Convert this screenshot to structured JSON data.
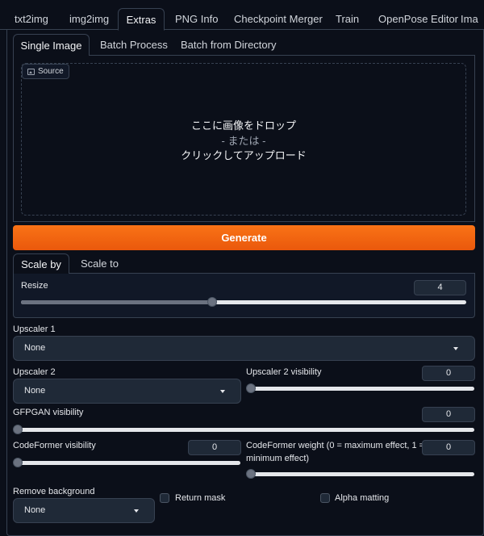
{
  "top_tabs": [
    "txt2img",
    "img2img",
    "Extras",
    "PNG Info",
    "Checkpoint Merger",
    "Train",
    "OpenPose Editor",
    "Ima"
  ],
  "sub_tabs": [
    "Single Image",
    "Batch Process",
    "Batch from Directory"
  ],
  "source": {
    "badge_label": "Source",
    "drop_line1": "ここに画像をドロップ",
    "drop_line2": "- または -",
    "drop_line3": "クリックしてアップロード"
  },
  "generate_label": "Generate",
  "scale_tabs": [
    "Scale by",
    "Scale to"
  ],
  "resize": {
    "label": "Resize",
    "value": "4",
    "fraction": 0.43
  },
  "upscaler1": {
    "label": "Upscaler 1",
    "selected": "None"
  },
  "upscaler2": {
    "label": "Upscaler 2",
    "selected": "None"
  },
  "upscaler2_visibility": {
    "label": "Upscaler 2 visibility",
    "value": "0",
    "fraction": 0
  },
  "gfpgan_visibility": {
    "label": "GFPGAN visibility",
    "value": "0",
    "fraction": 0
  },
  "codeformer_visibility": {
    "label": "CodeFormer visibility",
    "value": "0",
    "fraction": 0
  },
  "codeformer_weight": {
    "label_line1": "CodeFormer weight (0 = maximum effect, 1 =",
    "label_line2": "minimum effect)",
    "value": "0",
    "fraction": 0
  },
  "remove_background": {
    "label": "Remove background",
    "selected": "None"
  },
  "return_mask_label": "Return mask",
  "alpha_matting_label": "Alpha matting",
  "colors": {
    "background": "#0b0f19",
    "accent": "#f97316",
    "border": "#374151"
  }
}
